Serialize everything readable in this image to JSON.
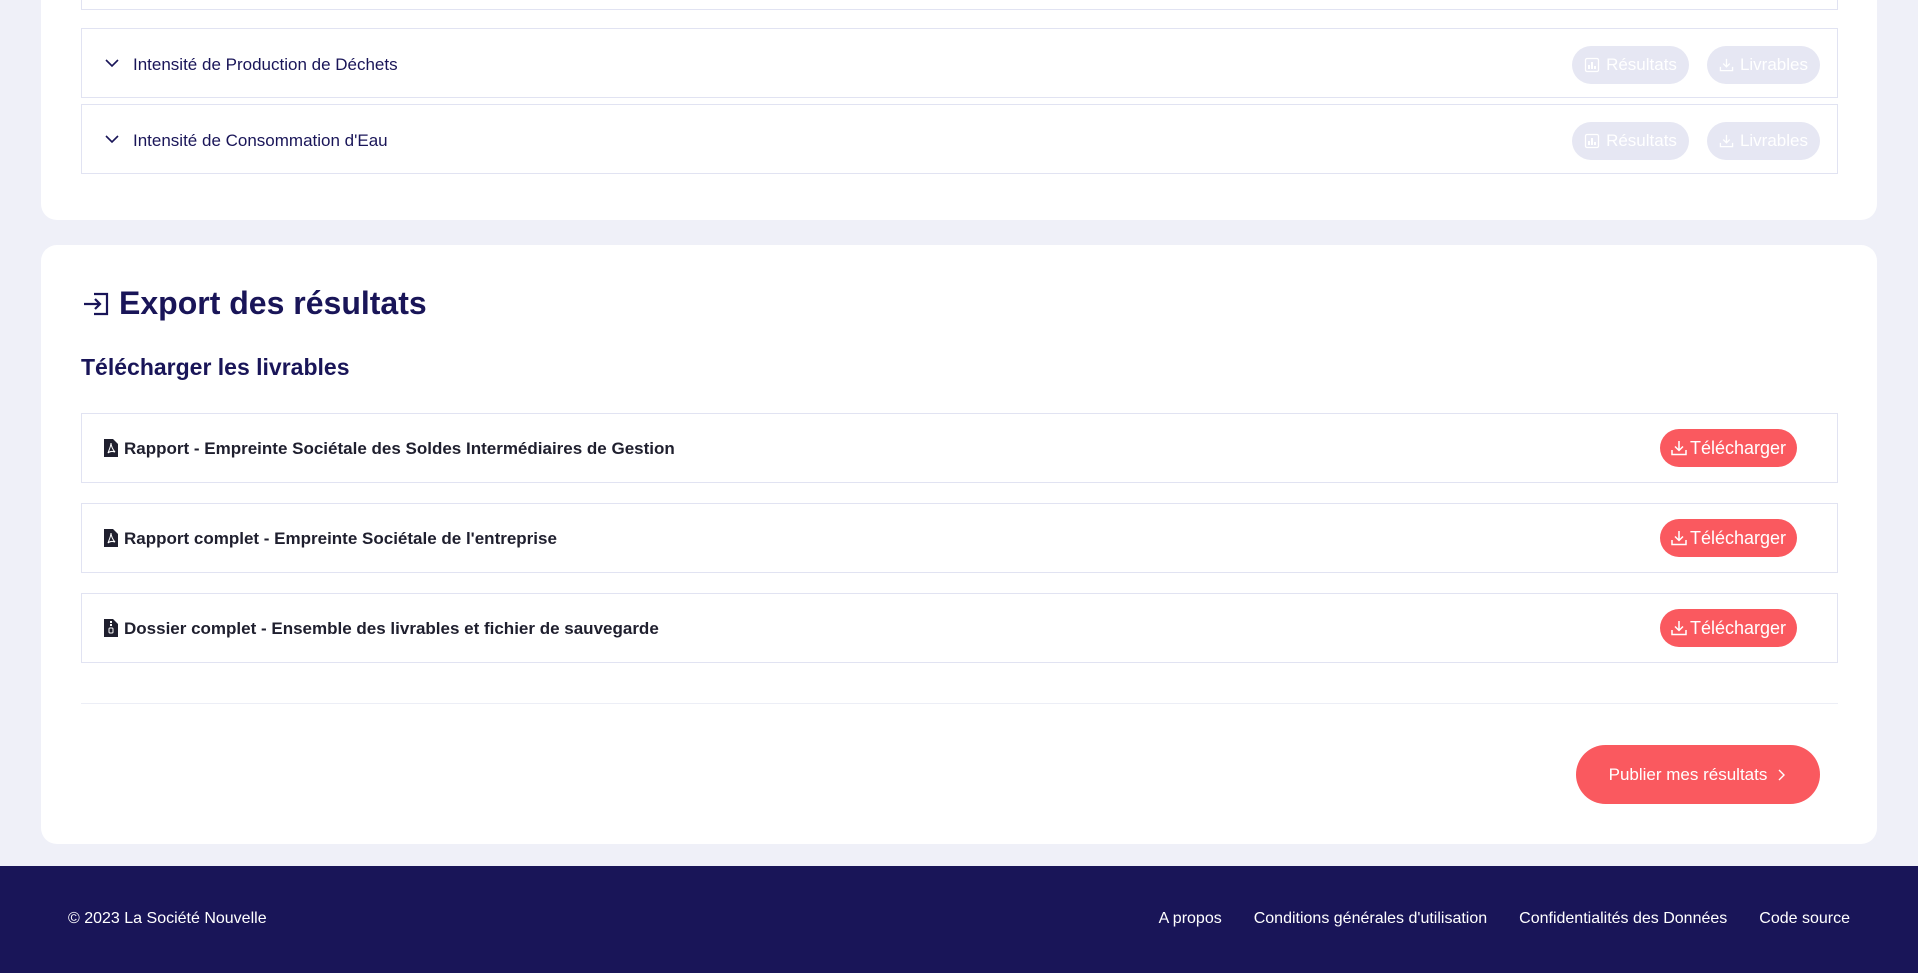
{
  "indicators": {
    "items": [
      {
        "label": ""
      },
      {
        "label": "Intensité de Production de Déchets"
      },
      {
        "label": "Intensité de Consommation d'Eau"
      }
    ],
    "results_label": "Résultats",
    "deliverables_label": "Livrables"
  },
  "export": {
    "title": "Export des résultats",
    "subtitle": "Télécharger les livrables",
    "download_label": "Télécharger",
    "rows": [
      {
        "label": "Rapport - Empreinte Sociétale des Soldes Intermédiaires de Gestion",
        "icon": "file-pdf-icon"
      },
      {
        "label": "Rapport complet - Empreinte Sociétale de l'entreprise",
        "icon": "file-pdf-icon"
      },
      {
        "label": "Dossier complet - Ensemble des livrables et fichier de sauvegarde",
        "icon": "file-zip-icon"
      }
    ],
    "publish_label": "Publier mes résultats"
  },
  "footer": {
    "copyright": "© 2023 La Société Nouvelle",
    "links": [
      {
        "label": "A propos"
      },
      {
        "label": "Conditions générales d'utilisation"
      },
      {
        "label": "Confidentialités des Données"
      },
      {
        "label": "Code source"
      }
    ]
  },
  "colors": {
    "primary": "#191558",
    "accent": "#fa595f",
    "disabled_button": "#e6e7f3",
    "background": "#eff0f8"
  }
}
